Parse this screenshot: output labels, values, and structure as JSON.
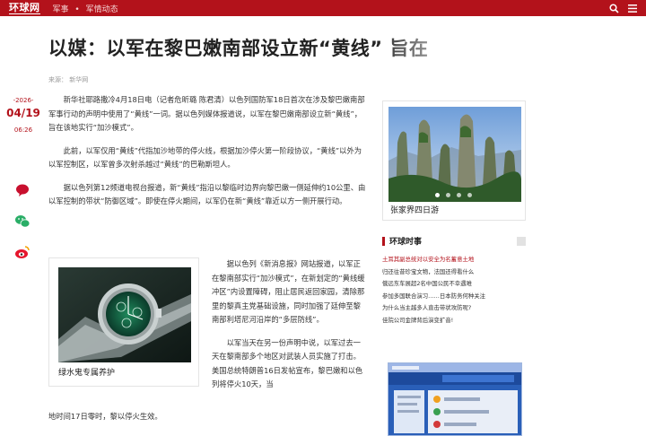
{
  "topbar": {
    "logo": "环球网",
    "crumb_1": "军事",
    "crumb_sep": "•",
    "crumb_2": "军情动态"
  },
  "article": {
    "title": "以媒：以军在黎巴嫩南部设立新“黄线” 旨在",
    "source": "来源：  新华网",
    "date_year": "-2026-",
    "date_md": "04/19",
    "time": "06:26",
    "paragraphs": [
      "新华社耶路撒冷4月18日电（记者危昕璐 陈君清）以色列国防军18日首次在涉及黎巴嫩南部军事行动的声明中使用了“黄线”一词。据以色列媒体报道说，以军在黎巴嫩南部设立新“黄线”，旨在该地实行“加沙模式”。",
      "此前，以军仅用“黄线”代指加沙地带的停火线，根据加沙停火第一阶段协议，“黄线”以外为以军控制区，以军曾多次射杀越过“黄线”的巴勒斯坦人。",
      "据以色列第12频道电视台报道，新“黄线”指沿以黎临时边界向黎巴嫩一侧延伸约10公里、由以军控制的带状“防御区域”。即使在停火期间，以军仍在新“黄线”靠近以方一侧开展行动。"
    ],
    "wrap_paragraphs": [
      "据以色列《新消息报》网站报道，以军正在黎南部实行“加沙模式”，在新划定的“黄线缓冲区”内设置障碍，阻止居民返回家园，清除那里的黎真主党基础设施，同时加强了廷伸至黎南部利塔尼河沿岸的“多层防线”。",
      "以军当天在另一份声明中说，以军过去一天在黎南部多个地区对武装人员实施了打击。美国总统特朗普16日发帖宣布，黎巴嫩和以色列将停火10天，当"
    ],
    "last_line": "地时间17日零时，黎以停火生效。"
  },
  "ad_left": {
    "caption": "绿水鬼专属养护"
  },
  "pic_card": {
    "caption": "张家界四日游"
  },
  "news": {
    "header": "环球时事",
    "items": [
      "土耳其副总统对以安全为名蓄意土地",
      "归还往昔珍宝文物，法国还得看什么",
      "俄远东车展超2名中国公民不幸遇难",
      "参加多国联合演习……日本防务何种关注",
      "为什么当主越多人直击带状攻防呢?",
      "佳院公司金牌背后演变扩音!"
    ]
  },
  "colors": {
    "brand_red": "#b3121b"
  },
  "icons": [
    "search-icon",
    "menu-icon",
    "comment-icon",
    "wechat-icon",
    "weibo-icon"
  ]
}
